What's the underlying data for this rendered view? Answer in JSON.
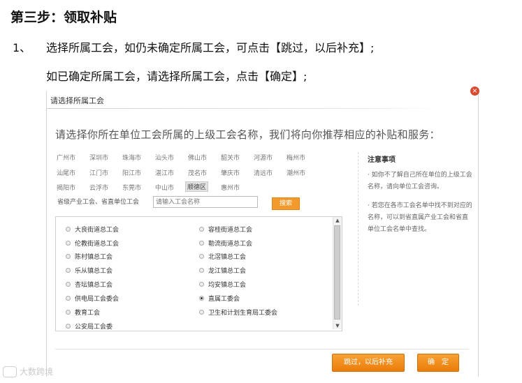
{
  "doc": {
    "heading": "第三步：领取补贴",
    "line1_number": "1、",
    "line1_text": "选择所属工会，如仍未确定所属工会，可点击【跳过，以后补充】;",
    "line2_text": "如已确定所属工会，请选择所属工会，点击【确定】;"
  },
  "dialog": {
    "title": "请选择所属工会",
    "prompt": "请选择你所在单位工会所属的上级工会名称，我们将向你推荐相应的补贴和服务：",
    "cities": [
      [
        "广州市",
        "深圳市",
        "珠海市",
        "汕头市",
        "佛山市",
        "韶关市",
        "河源市",
        "梅州市"
      ],
      [
        "汕尾市",
        "江门市",
        "阳江市",
        "湛江市",
        "茂名市",
        "肇庆市",
        "清远市",
        "潮州市"
      ],
      [
        "揭阳市",
        "云浮市",
        "东莞市",
        "中山市",
        "顺德区",
        "惠州市"
      ]
    ],
    "selected_city": "顺德区",
    "dept_label": "省级产业工会、省直单位工会",
    "search_placeholder": "请输入工会名称",
    "search_button": "搜索",
    "union_options_left": [
      "大良街道总工会",
      "伦教街道总工会",
      "陈村镇总工会",
      "乐从镇总工会",
      "杏坛镇总工会",
      "供电局工会委会",
      "教育工会",
      "公安局工会委"
    ],
    "union_options_right": [
      "容桂街道总工会",
      "勒流街道总工会",
      "北滘镇总工会",
      "龙江镇总工会",
      "均安镇总工会",
      "直属工委会",
      "卫生和计划生育局工委会"
    ],
    "selected_union": "直属工委会",
    "notes_title": "注意事项",
    "note1": "· 如你不了解自己所在单位的上级工会名称，请向单位工会咨询。",
    "note2": "· 若您在各市工会名单中找不到对应的名称，可以到省直属产业工会和省直单位工会名单中查找。",
    "skip_button": "跳过，以后补充",
    "confirm_button": "确　定",
    "close_symbol": "×"
  },
  "watermark": "大数跨境",
  "colors": {
    "accent": "#f39a2c",
    "close_red": "#d84a2f"
  }
}
